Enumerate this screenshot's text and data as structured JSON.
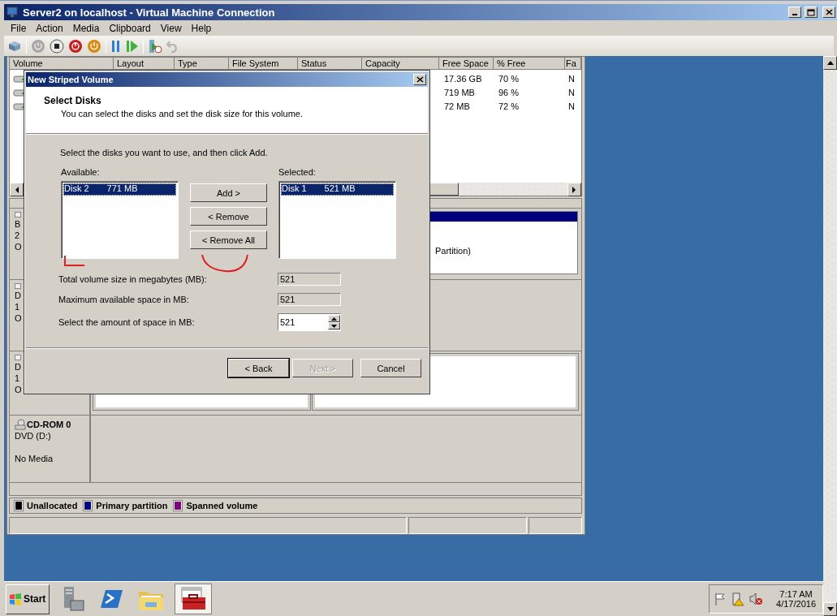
{
  "vm_window": {
    "title": "Server2 on localhost - Virtual Machine Connection",
    "menu": [
      "File",
      "Action",
      "Media",
      "Clipboard",
      "View",
      "Help"
    ],
    "toolbar": [
      {
        "kind": "ctrl-alt-del",
        "disabled": false
      },
      {
        "kind": "separator"
      },
      {
        "kind": "start",
        "disabled": true
      },
      {
        "kind": "turn-off",
        "disabled": false
      },
      {
        "kind": "shut-down",
        "disabled": false
      },
      {
        "kind": "save",
        "disabled": false
      },
      {
        "kind": "separator"
      },
      {
        "kind": "pause",
        "disabled": false
      },
      {
        "kind": "reset",
        "disabled": false
      },
      {
        "kind": "separator"
      },
      {
        "kind": "checkpoint",
        "disabled": false
      },
      {
        "kind": "revert",
        "disabled": true
      }
    ]
  },
  "disk_management": {
    "volume_columns": [
      "Volume",
      "Layout",
      "Type",
      "File System",
      "Status",
      "Capacity",
      "Free Space",
      "% Free",
      "Fa"
    ],
    "volume_rows": [
      {
        "free_space": "17.36 GB",
        "percent_free": "70 %",
        "column_9": "N"
      },
      {
        "free_space": "719 MB",
        "percent_free": "96 %",
        "column_9": "N"
      },
      {
        "free_space": "72 MB",
        "percent_free": "72 %",
        "column_9": "N"
      }
    ],
    "disks": [
      {
        "kind": "single",
        "label_lines": [
          "B",
          "2",
          "O"
        ],
        "partition_text": "Partition)"
      },
      {
        "kind": "hidden",
        "label_lines": [
          "D",
          "1",
          "O"
        ]
      },
      {
        "kind": "split",
        "label_lines": [
          "D",
          "1",
          "O"
        ]
      }
    ],
    "cdrom": {
      "name": "CD-ROM 0",
      "type": "DVD (D:)",
      "status": "No Media"
    },
    "legend": [
      {
        "label": "Unallocated",
        "color": "#000000"
      },
      {
        "label": "Primary partition",
        "color": "#00007f"
      },
      {
        "label": "Spanned volume",
        "color": "#800080"
      }
    ]
  },
  "dialog": {
    "title": "New Striped Volume",
    "heading": "Select Disks",
    "subheading": "You can select the disks and set the disk size for this volume.",
    "instruction": "Select the disks you want to use, and then click Add.",
    "available": {
      "label": "Available:",
      "items": [
        {
          "name": "Disk 2",
          "size": "771 MB",
          "selected": true
        }
      ]
    },
    "selected_disks": {
      "label": "Selected:",
      "items": [
        {
          "name": "Disk 1",
          "size": "521 MB",
          "selected": true
        }
      ]
    },
    "actions": [
      "Add >",
      "< Remove",
      "< Remove All"
    ],
    "fields": [
      {
        "label": "Total volume size in megabytes (MB):",
        "value": "521",
        "kind": "readonly"
      },
      {
        "label": "Maximum available space in MB:",
        "value": "521",
        "kind": "readonly"
      },
      {
        "label": "Select the amount of space in MB:",
        "value": "521",
        "kind": "spinner"
      }
    ],
    "buttons": [
      {
        "label": "< Back",
        "disabled": false
      },
      {
        "label": "Next >",
        "disabled": true
      },
      {
        "label": "Cancel",
        "disabled": false
      }
    ]
  },
  "taskbar": {
    "start": "Start",
    "apps": [
      {
        "kind": "server-manager",
        "selected": false
      },
      {
        "kind": "powershell",
        "selected": false
      },
      {
        "kind": "explorer",
        "selected": false
      },
      {
        "kind": "toolbox",
        "selected": true
      }
    ],
    "clock": {
      "time": "7:17 AM",
      "date": "4/17/2016"
    }
  }
}
